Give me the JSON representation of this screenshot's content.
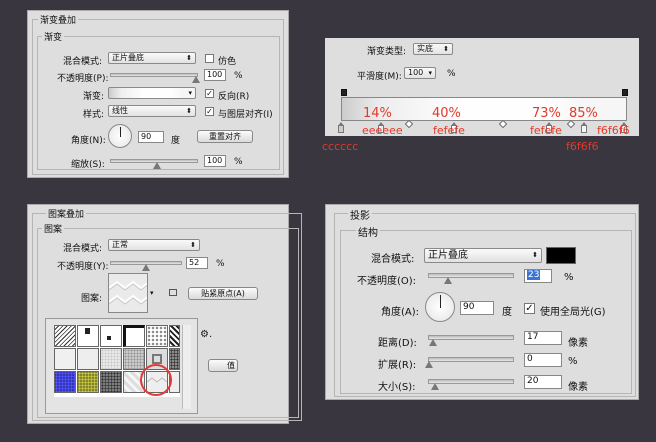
{
  "gradient_overlay": {
    "title": "渐变叠加",
    "section": "渐变",
    "blend_mode_label": "混合模式:",
    "blend_mode_value": "正片叠底",
    "dither_label": "仿色",
    "opacity_label": "不透明度(P):",
    "opacity_value": "100",
    "gradient_label": "渐变:",
    "reverse_label": "反向(R)",
    "reverse_checked": "✓",
    "style_label": "样式:",
    "style_value": "线性",
    "align_label": "与图层对齐(I)",
    "align_checked": "✓",
    "angle_label": "角度(N):",
    "angle_value": "90",
    "angle_unit": "度",
    "reset_align_button": "重置对齐",
    "scale_label": "缩放(S):",
    "scale_value": "100",
    "percent": "%"
  },
  "gradient_editor": {
    "type_label": "渐变类型:",
    "type_value": "实底",
    "smooth_label": "平滑度(M):",
    "smooth_value": "100",
    "percent": "%",
    "positions": [
      "14%",
      "40%",
      "73%",
      "85%"
    ],
    "colors_top": [
      "eeeeee",
      "fefefe",
      "fefefe",
      "f6f6f6"
    ],
    "color_left_bottom": "cccccc",
    "color_right_bottom": "f6f6f6"
  },
  "pattern_overlay": {
    "title": "图案叠加",
    "section": "图案",
    "blend_mode_label": "混合模式:",
    "blend_mode_value": "正常",
    "opacity_label": "不透明度(Y):",
    "opacity_value": "52",
    "percent": "%",
    "pattern_label": "图案:",
    "snap_origin_button": "贴紧原点(A)",
    "hidden_button_tail": "值",
    "gear": "⚙."
  },
  "drop_shadow": {
    "title": "投影",
    "section": "结构",
    "blend_mode_label": "混合模式:",
    "blend_mode_value": "正片叠底",
    "shadow_color": "#000000",
    "opacity_label": "不透明度(O):",
    "opacity_value": "23",
    "percent": "%",
    "angle_label": "角度(A):",
    "angle_value": "90",
    "angle_unit": "度",
    "global_light_label": "使用全局光(G)",
    "global_light_checked": "✓",
    "distance_label": "距离(D):",
    "distance_value": "17",
    "spread_label": "扩展(R):",
    "spread_value": "0",
    "size_label": "大小(S):",
    "size_value": "20",
    "unit_px": "像素",
    "unit_percent": "%"
  }
}
